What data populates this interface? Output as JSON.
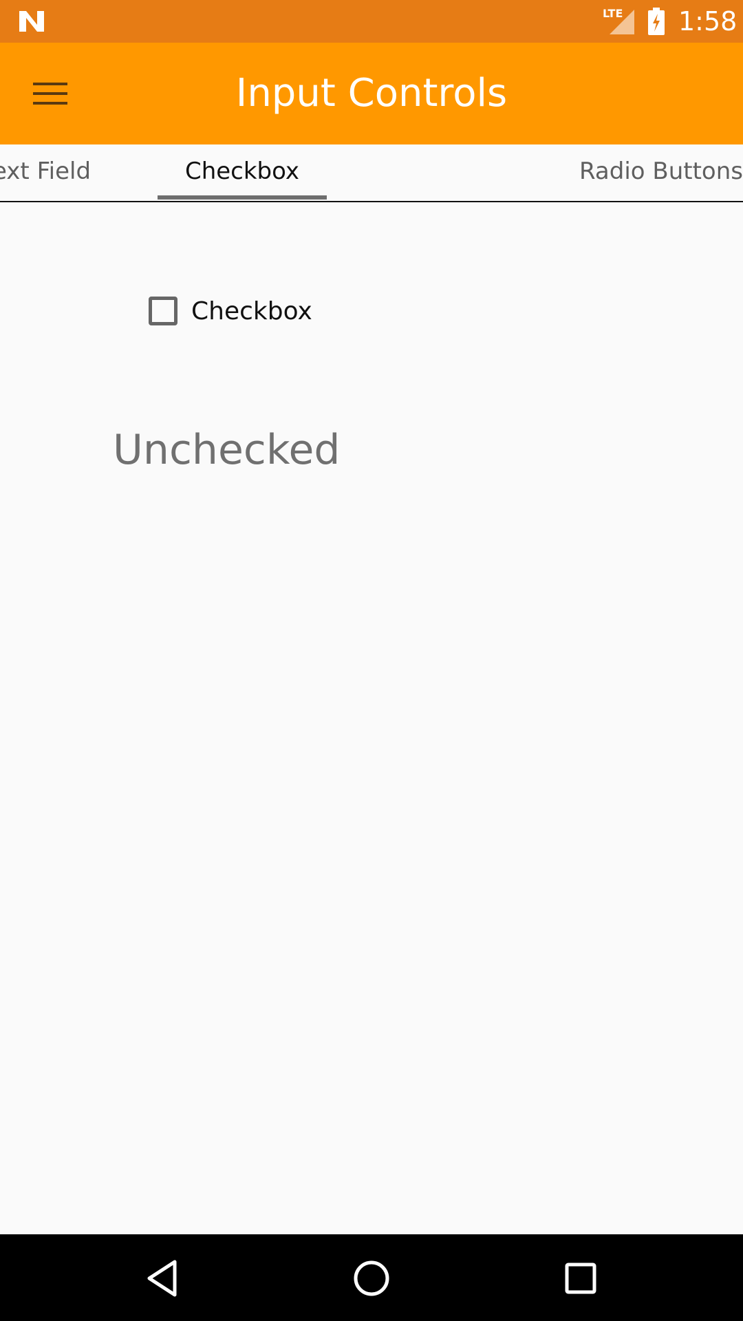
{
  "status_bar": {
    "time": "1:58",
    "network_label": "LTE",
    "icons": [
      "n-logo-icon",
      "lte-signal-icon",
      "battery-charging-icon"
    ]
  },
  "app_bar": {
    "title": "Input Controls",
    "menu_icon": "hamburger-menu-icon"
  },
  "tabs": [
    {
      "label": "Text Field",
      "visible_text": "t Field",
      "active": false
    },
    {
      "label": "Checkbox",
      "visible_text": "Checkbox",
      "active": true
    },
    {
      "label": "Radio Buttons",
      "visible_text": "Radio Buttons",
      "active": false
    }
  ],
  "content": {
    "checkbox": {
      "label": "Checkbox",
      "checked": false
    },
    "status_text": "Unchecked"
  },
  "nav_bar": {
    "icons": [
      "back-icon",
      "home-icon",
      "recents-icon"
    ]
  },
  "colors": {
    "status_bar": "#e67c15",
    "app_bar": "#ff9800",
    "background": "#fafafa",
    "nav_bar": "#000000"
  }
}
